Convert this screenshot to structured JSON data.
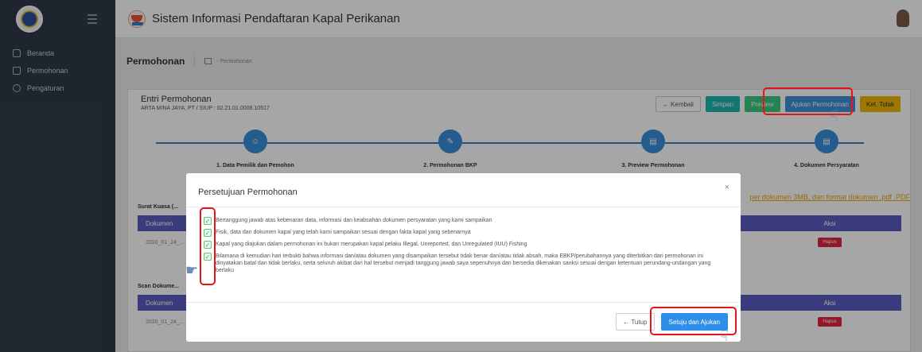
{
  "sidebar": {
    "items": [
      {
        "label": "Beranda",
        "icon": "monitor-icon"
      },
      {
        "label": "Permohonan",
        "icon": "document-icon"
      },
      {
        "label": "Pengaturan",
        "icon": "gear-icon"
      }
    ]
  },
  "header": {
    "title": "Sistem Informasi Pendaftaran Kapal Perikanan"
  },
  "breadcrumb": {
    "title": "Permohonan",
    "trail": "- Permohonan"
  },
  "entry": {
    "title": "Entri Permohonan",
    "subtitle": "ARTA MINA JAYA, PT / SIUP : 02.21.01.0006.10517",
    "buttons": {
      "back": "← Kembali",
      "save": "Simpan",
      "preview": "Preview",
      "submit": "Ajukan Permohonan",
      "reject": "Ket. Tolak"
    }
  },
  "steps": [
    {
      "label": "1. Data Pemilik dan Pemohon"
    },
    {
      "label": "2. Permohonan BKP"
    },
    {
      "label": "3. Preview Permohonan"
    },
    {
      "label": "4. Dokumen Persyaratan"
    }
  ],
  "upload_note": "per dokumen 3MB, dan format dokumen .pdf .PDF",
  "sections": [
    {
      "title": "Surat Kuasa (...",
      "col_doc": "Dokumen",
      "col_action": "Aksi",
      "row_file": "2020_01_24_...",
      "delete": "Hapus"
    },
    {
      "title": "Scan Dokume...",
      "col_doc": "Dokumen",
      "col_action": "Aksi",
      "row_file": "2020_01_24_...",
      "delete": "Hapus"
    }
  ],
  "modal": {
    "title": "Persetujuan Permohonan",
    "close": "×",
    "items": [
      "Bertanggung jawab atas kebenaran data, informasi dan keabsahan dokumen persyaratan yang kami sampaikan",
      "Fisik, data dan dokumen kapal yang telah kami sampaikan sesuai dengan fakta kapal yang sebenarnya",
      "Kapal yang diajukan dalam permohonan ini bukan merupakan kapal pelaku Illegal, Unreported, dan Unregulated (IUU) Fishing",
      "Bilamana di kemudian hari terbukti bahwa informasi dan/atau dokumen yang disampaikan tersebut tidak benar dan/atau tidak absah, maka EBKP/perubahannya yang diterbitkan dari permohonan ini dinyatakan batal dan tidak berlaku, serta seluruh akibat dari hal tersebut menjadi tanggung jawab saya sepenuhnya dan bersedia dikenakan sanksi sesuai dengan ketentuan perundang-undangan yang berlaku"
    ],
    "close_button": "← Tutup",
    "agree_button": "Setuju dan Ajukan"
  }
}
